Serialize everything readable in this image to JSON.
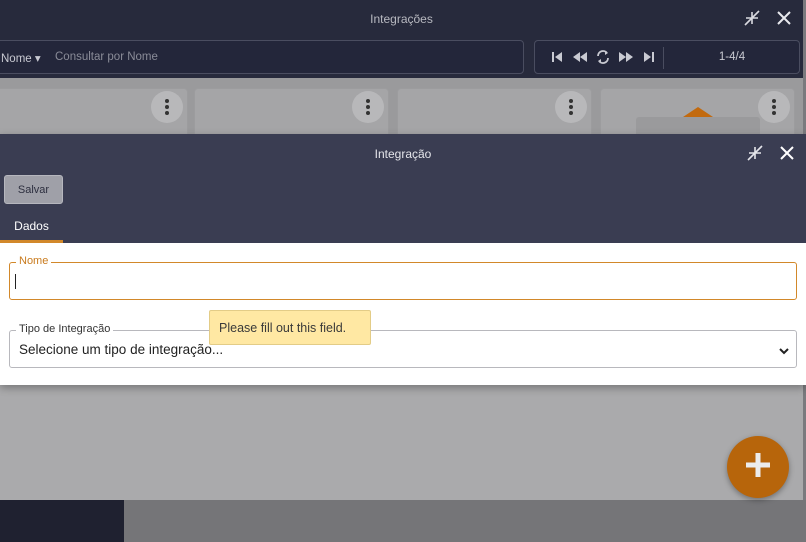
{
  "back_window": {
    "title": "Integrações",
    "search_field": "Nome",
    "search_placeholder": "Consultar por Nome",
    "pager_count": "1-4/4"
  },
  "modal": {
    "title": "Integração",
    "save_label": "Salvar",
    "tab_label": "Dados",
    "nome_label": "Nome",
    "nome_value": "",
    "tipo_label": "Tipo de Integração",
    "tipo_value": "Selecione um tipo de integração..."
  },
  "tooltip": "Please fill out this field.",
  "colors": {
    "header": "#3a3d52",
    "accent": "#d2882a",
    "fab": "#b7650b"
  },
  "icons": [
    "collapse-icon",
    "close-icon",
    "first-page-icon",
    "prev-page-icon",
    "refresh-icon",
    "next-page-icon",
    "last-page-icon",
    "kebab-menu-icon",
    "plus-icon",
    "chevron-down-icon"
  ]
}
